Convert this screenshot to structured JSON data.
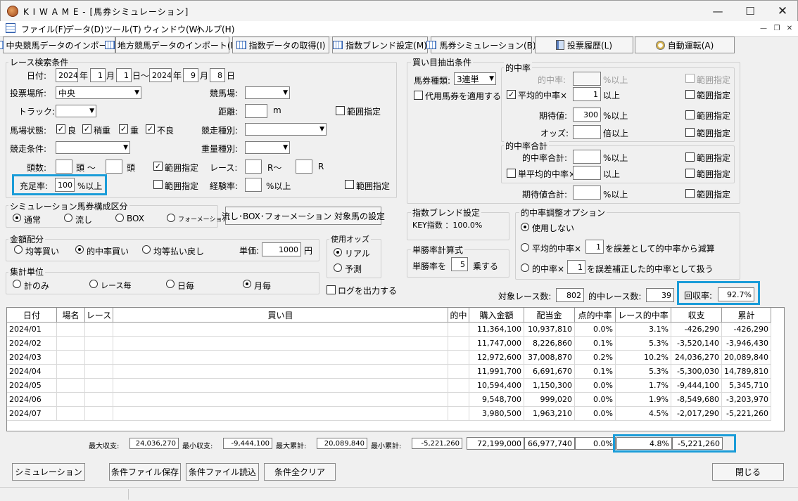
{
  "window": {
    "title": "K I W A M E - [馬券シミュレーション]"
  },
  "menu": [
    "ファイル(F)",
    "データ(D)",
    "ツール(T)",
    "ウィンドウ(W)",
    "ヘルプ(H)"
  ],
  "toolbar": [
    "中央競馬データのインポート(J)",
    "地方競馬データのインポート(N)",
    "指数データの取得(I)",
    "指数ブレンド設定(M)",
    "馬券シミュレーション(B)",
    "投票履歴(L)",
    "自動運転(A)"
  ],
  "race": {
    "title": "レース検索条件",
    "date_label": "日付:",
    "from_year": "2024",
    "year": "年",
    "from_month": "1",
    "month": "月",
    "from_day": "1",
    "day_tilde": "日～",
    "to_year": "2024",
    "to_month": "9",
    "to_day": "8",
    "day": "日",
    "venue_label": "投票場所:",
    "venue": "中央",
    "course_label": "競馬場:",
    "track_label": "トラック:",
    "distance_label": "距離:",
    "distance_unit": "m",
    "range": "範囲指定",
    "condition_label": "馬場状態:",
    "conditions": [
      "良",
      "稍重",
      "重",
      "不良"
    ],
    "race_type_label": "競走種別:",
    "race_cond_label": "競走条件:",
    "weight_type_label": "重量種別:",
    "heads_label": "頭数:",
    "heads_mid": "頭 ～",
    "heads_end": "頭",
    "race_label": "レース:",
    "race_mid": "R～",
    "race_end": "R",
    "fill_label": "充足率:",
    "fill_value": "100",
    "fill_unit": "%以上",
    "exp_label": "経験率:",
    "exp_unit": "%以上"
  },
  "sim": {
    "title": "シミュレーション馬券構成区分",
    "options": [
      "通常",
      "流し",
      "BOX",
      "フォーメーション"
    ],
    "config_button": "流し･BOX･フォーメーション 対象馬の設定"
  },
  "money": {
    "title": "金額配分",
    "options": [
      "均等買い",
      "的中率買い",
      "均等払い戻し"
    ],
    "unit_label": "単価:",
    "unit_value": "1000",
    "unit_yen": "円"
  },
  "odds": {
    "title": "使用オッズ",
    "options": [
      "リアル",
      "予測"
    ]
  },
  "agg": {
    "title": "集計単位",
    "options": [
      "計のみ",
      "レース毎",
      "日毎",
      "月毎"
    ]
  },
  "log_label": "ログを出力する",
  "buy": {
    "title": "買い目抽出条件",
    "type_label": "馬券種類:",
    "type_value": "3連単",
    "substitute": "代用馬券を適用する",
    "hit_title": "的中率",
    "hit_label": "的中率:",
    "pct_over": "%以上",
    "avg_hit": "平均的中率×",
    "avg_hit_value": "1",
    "over": "以上",
    "exp_label": "期待値:",
    "exp_value": "300",
    "odds_label": "オッズ:",
    "odds_unit": "倍以上",
    "sum_title": "的中率合計",
    "sum_label": "的中率合計:",
    "single_avg": "単平均的中率×",
    "exp_sum_label": "期待値合計:",
    "range": "範囲指定"
  },
  "blend": {
    "title": "指数ブレンド設定",
    "text": "KEY指数 ：100.0%"
  },
  "odds_calc": {
    "title": "単勝率計算式",
    "prefix": "単勝率を",
    "value": "5",
    "suffix": "乗する"
  },
  "adjust": {
    "title": "的中率調整オプション",
    "opt1": "使用しない",
    "opt2_pre": "平均的中率×",
    "opt2_val": "1",
    "opt2_post": "を誤差として的中率から減算",
    "opt3_pre": "的中率×",
    "opt3_val": "1",
    "opt3_post": "を誤差補正した的中率として扱う"
  },
  "stats": {
    "target_label": "対象レース数:",
    "target": "802",
    "hit_label": "的中レース数:",
    "hit": "39",
    "return_label": "回収率:",
    "return": "92.7%"
  },
  "table": {
    "headers": [
      "日付",
      "場名",
      "レース",
      "買い目",
      "的中",
      "購入金額",
      "配当金",
      "点的中率",
      "レース的中率",
      "収支",
      "累計"
    ],
    "rows": [
      [
        "2024/01",
        "",
        "",
        "",
        "",
        "11,364,100",
        "10,937,810",
        "0.0%",
        "3.1%",
        "-426,290",
        "-426,290"
      ],
      [
        "2024/02",
        "",
        "",
        "",
        "",
        "11,747,000",
        "8,226,860",
        "0.1%",
        "5.3%",
        "-3,520,140",
        "-3,946,430"
      ],
      [
        "2024/03",
        "",
        "",
        "",
        "",
        "12,972,600",
        "37,008,870",
        "0.2%",
        "10.2%",
        "24,036,270",
        "20,089,840"
      ],
      [
        "2024/04",
        "",
        "",
        "",
        "",
        "11,991,700",
        "6,691,670",
        "0.1%",
        "5.3%",
        "-5,300,030",
        "14,789,810"
      ],
      [
        "2024/05",
        "",
        "",
        "",
        "",
        "10,594,400",
        "1,150,300",
        "0.0%",
        "1.7%",
        "-9,444,100",
        "5,345,710"
      ],
      [
        "2024/06",
        "",
        "",
        "",
        "",
        "9,548,700",
        "999,020",
        "0.0%",
        "1.9%",
        "-8,549,680",
        "-3,203,970"
      ],
      [
        "2024/07",
        "",
        "",
        "",
        "",
        "3,980,500",
        "1,963,210",
        "0.0%",
        "4.5%",
        "-2,017,290",
        "-5,221,260"
      ]
    ]
  },
  "totals": {
    "max_income_label": "最大収支:",
    "max_income": "24,036,270",
    "min_income_label": "最小収支:",
    "min_income": "-9,444,100",
    "max_cum_label": "最大累計:",
    "max_cum": "20,089,840",
    "min_cum_label": "最小累計:",
    "min_cum": "-5,221,260",
    "purchase": "72,199,000",
    "payout": "66,977,740",
    "point_hit": "0.0%",
    "race_hit": "4.8%",
    "income": "-5,221,260"
  },
  "buttons": {
    "simulate": "シミュレーション",
    "save": "条件ファイル保存",
    "load": "条件ファイル読込",
    "clear": "条件全クリア",
    "close": "閉じる"
  }
}
